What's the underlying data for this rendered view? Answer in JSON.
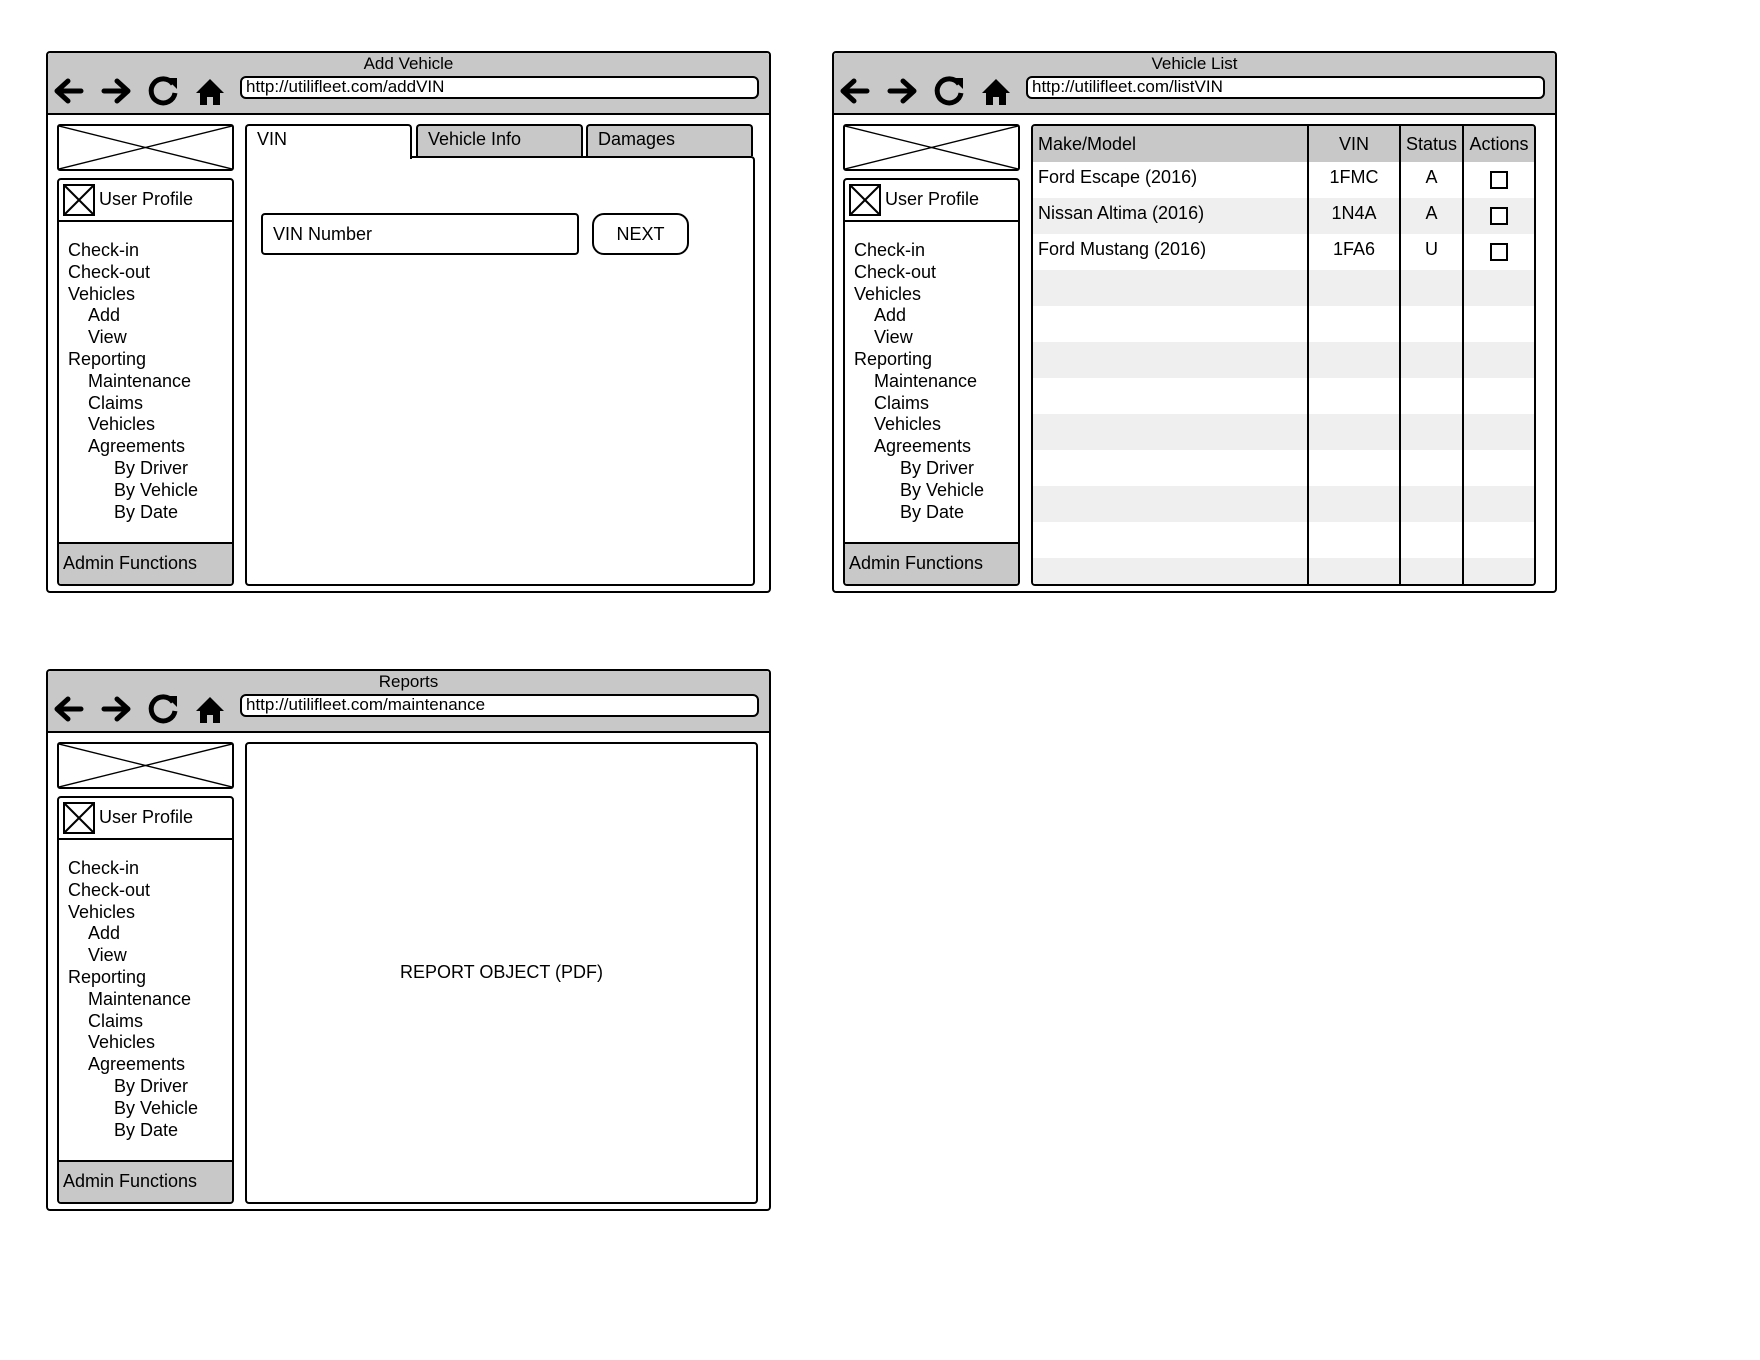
{
  "windows": {
    "add_vehicle": {
      "title": "Add Vehicle",
      "url": "http://utilifleet.com/addVIN",
      "tabs": [
        "VIN",
        "Vehicle Info",
        "Damages"
      ],
      "vin_placeholder": "VIN Number",
      "next_label": "NEXT"
    },
    "vehicle_list": {
      "title": "Vehicle List",
      "url": "http://utilifleet.com/listVIN",
      "columns": [
        "Make/Model",
        "VIN",
        "Status",
        "Actions"
      ],
      "rows": [
        {
          "make_model": "Ford Escape (2016)",
          "vin": "1FMC",
          "status": "A"
        },
        {
          "make_model": "Nissan Altima (2016)",
          "vin": "1N4A",
          "status": "A"
        },
        {
          "make_model": "Ford Mustang (2016)",
          "vin": "1FA6",
          "status": "U"
        }
      ]
    },
    "reports": {
      "title": "Reports",
      "url": "http://utilifleet.com/maintenance",
      "report_object": "REPORT OBJECT (PDF)"
    }
  },
  "sidebar": {
    "profile_label": "User Profile",
    "items": [
      {
        "label": "Check-in",
        "level": 0
      },
      {
        "label": "Check-out",
        "level": 0
      },
      {
        "label": "Vehicles",
        "level": 0
      },
      {
        "label": "Add",
        "level": 1
      },
      {
        "label": "View",
        "level": 1
      },
      {
        "label": "Reporting",
        "level": 0
      },
      {
        "label": "Maintenance",
        "level": 1
      },
      {
        "label": "Claims",
        "level": 1
      },
      {
        "label": "Vehicles",
        "level": 1
      },
      {
        "label": "Agreements",
        "level": 1
      },
      {
        "label": "By Driver",
        "level": 2
      },
      {
        "label": "By Vehicle",
        "level": 2
      },
      {
        "label": "By Date",
        "level": 2
      }
    ],
    "admin_label": "Admin Functions"
  },
  "icons": [
    "back-arrow-icon",
    "forward-arrow-icon",
    "reload-icon",
    "home-icon",
    "image-placeholder-icon",
    "avatar-placeholder-icon",
    "checkbox-icon"
  ],
  "colors": {
    "chrome_gray": "#c8c8c8",
    "stripe_gray": "#efefef",
    "border": "#000000"
  }
}
